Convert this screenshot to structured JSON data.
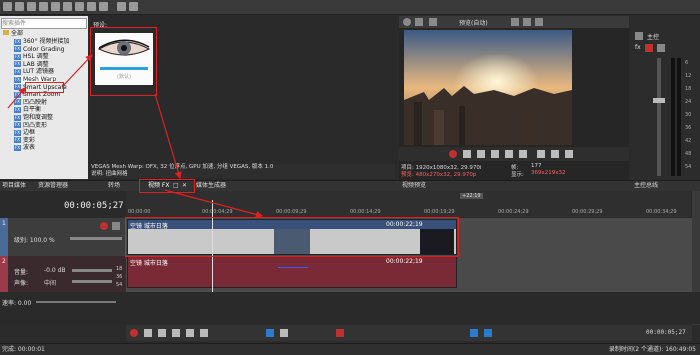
{
  "fx_panel": {
    "search_placeholder": "搜索插件",
    "root": "全部",
    "items": [
      "360° 视频拼接加",
      "Color Grading",
      "HSL 调整",
      "LAB 调整",
      "LUT 滤镜器",
      "Mesh Warp",
      "Smart Upscale",
      "Smart Zoom",
      "凹凸映射",
      "白平衡",
      "饱和度调整",
      "凹凸变形",
      "边框",
      "变彩",
      "波表"
    ],
    "selected_item": "Mesh Warp"
  },
  "preset_panel": {
    "label": "预设:",
    "thumb_caption": "(默认)",
    "description_line1": "VEGAS Mesh Warp: OFX, 32 位浮点, GPU 加速, 分组 VEGAS, 版本 1.0",
    "description_line2": "说明: 扭曲网格"
  },
  "tabs": {
    "project_media": "项目媒体",
    "explorer": "资源管理器",
    "transitions": "转场",
    "video_fx": "视频 FX",
    "media_generators": "媒体生成器",
    "preview_tab": "视频预览",
    "master_bus": "主控总线"
  },
  "preview": {
    "quality": "预览(自动)",
    "project_info": "项目: 1920x1080x32, 29.970i",
    "preview_info": "预览: 480x270x32, 29.970p",
    "frame_label": "帧:",
    "frame_value": "177",
    "display_label": "显示:",
    "display_value": "369x219x32"
  },
  "mixer": {
    "title": "主控",
    "scale": [
      "6",
      "12",
      "18",
      "24",
      "30",
      "36",
      "42",
      "48",
      "54"
    ]
  },
  "timeline": {
    "timecode": "00:00:05;27",
    "ruler_marks": [
      "00:00:00",
      "00:00:04;29",
      "00:00:09;29",
      "00:00:14;29",
      "00:00:19;29",
      "00:00:24;29",
      "00:00:29;29",
      "00:00:34;29"
    ],
    "cursor_marker": "+22:19",
    "video_track": {
      "number": "1",
      "level": "级别: 100.0 %"
    },
    "audio_track": {
      "number": "2",
      "volume": "音量:",
      "volume_value": "-0.0 dB",
      "pan": "声像:",
      "pan_value": "中间"
    },
    "video_event": {
      "title": "空镜 城市日落",
      "duration": "00:00:22;19"
    },
    "audio_event": {
      "title": "空镜 城市日落",
      "duration": "00:00:22;19"
    },
    "audio_scale": [
      "18",
      "36",
      "54"
    ]
  },
  "transport": {
    "rate_label": "速率: 0.00",
    "end_time": "00:00:05;27"
  },
  "status": {
    "left": "完成: 00:00:01",
    "right": "录制时间(2 个通道): 160:49:05"
  },
  "colors": {
    "annotation_red": "#e02020",
    "video_event": "#38507a",
    "audio_event": "#7a2a36",
    "fx_tag": "#4a7fd0"
  }
}
